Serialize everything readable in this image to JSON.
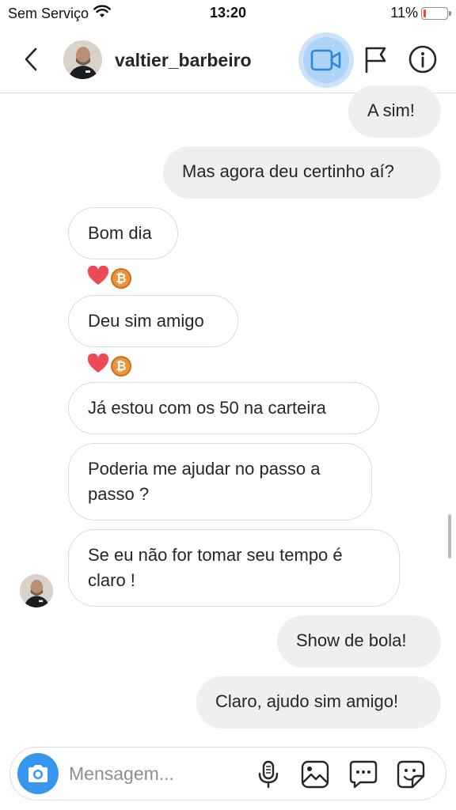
{
  "status_bar": {
    "carrier": "Sem Serviço",
    "time": "13:20",
    "battery_percent": "11%",
    "battery_level": 0.11
  },
  "header": {
    "username": "valtier_barbeiro"
  },
  "messages": [
    {
      "id": "m1",
      "direction": "sent",
      "text": "A sim!"
    },
    {
      "id": "m2",
      "direction": "sent",
      "text": "Mas agora deu certinho aí?"
    },
    {
      "id": "m3",
      "direction": "received",
      "text": "Bom dia",
      "reactions": [
        "heart",
        "bitcoin"
      ]
    },
    {
      "id": "m4",
      "direction": "received",
      "text": "Deu sim amigo",
      "reactions": [
        "heart",
        "bitcoin"
      ]
    },
    {
      "id": "m5",
      "direction": "received",
      "text": "Já estou com os 50 na carteira"
    },
    {
      "id": "m6",
      "direction": "received",
      "text": "Poderia me ajudar no passo a passo ?"
    },
    {
      "id": "m7",
      "direction": "received",
      "text": "Se eu não for tomar seu tempo é claro !"
    },
    {
      "id": "m8",
      "direction": "sent",
      "text": "Show de bola!"
    },
    {
      "id": "m9",
      "direction": "sent",
      "text": "Claro, ajudo sim amigo!"
    }
  ],
  "reaction_glyphs": {
    "heart": "❤",
    "bitcoin": "₿"
  },
  "composer": {
    "placeholder": "Mensagem..."
  },
  "colors": {
    "accent": "#3797f0",
    "heart": "#ed4956",
    "bitcoin": "#e8943a",
    "sent_bubble": "#efefef",
    "border": "#dbdbdb"
  },
  "icons": [
    "chevron-left-icon",
    "video-camera-icon",
    "flag-icon",
    "info-icon",
    "wifi-icon",
    "camera-icon",
    "microphone-icon",
    "image-icon",
    "chat-bubble-icon",
    "sticker-icon"
  ]
}
